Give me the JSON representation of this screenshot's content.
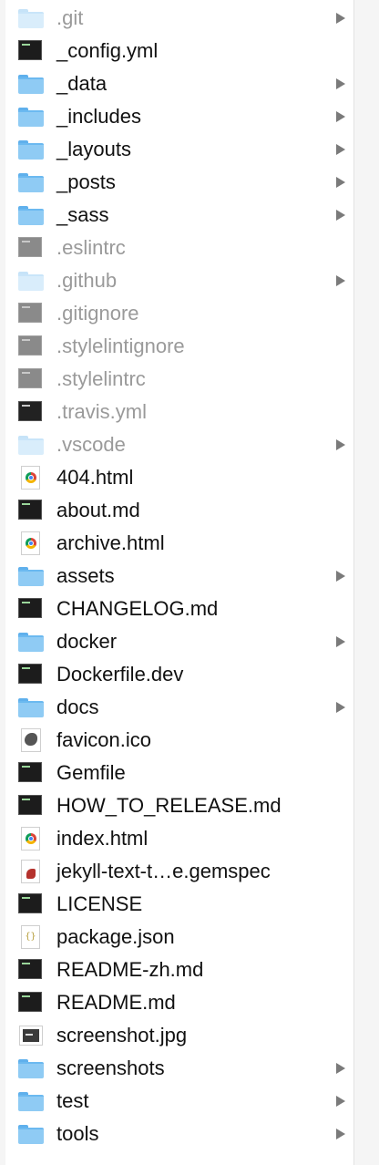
{
  "files": [
    {
      "name": ".git",
      "kind": "folder",
      "hidden": true,
      "expandable": true
    },
    {
      "name": "_config.yml",
      "kind": "terminal-file",
      "hidden": false,
      "expandable": false
    },
    {
      "name": "_data",
      "kind": "folder",
      "hidden": false,
      "expandable": true
    },
    {
      "name": "_includes",
      "kind": "folder",
      "hidden": false,
      "expandable": true
    },
    {
      "name": "_layouts",
      "kind": "folder",
      "hidden": false,
      "expandable": true
    },
    {
      "name": "_posts",
      "kind": "folder",
      "hidden": false,
      "expandable": true
    },
    {
      "name": "_sass",
      "kind": "folder",
      "hidden": false,
      "expandable": true
    },
    {
      "name": ".eslintrc",
      "kind": "terminal-file",
      "hidden": true,
      "expandable": false
    },
    {
      "name": ".github",
      "kind": "folder",
      "hidden": true,
      "expandable": true
    },
    {
      "name": ".gitignore",
      "kind": "terminal-file",
      "hidden": true,
      "expandable": false
    },
    {
      "name": ".stylelintignore",
      "kind": "terminal-file",
      "hidden": true,
      "expandable": false
    },
    {
      "name": ".stylelintrc",
      "kind": "terminal-file",
      "hidden": true,
      "expandable": false
    },
    {
      "name": ".travis.yml",
      "kind": "terminal-file-dark",
      "hidden": true,
      "expandable": false
    },
    {
      "name": ".vscode",
      "kind": "folder",
      "hidden": true,
      "expandable": true
    },
    {
      "name": "404.html",
      "kind": "html-file",
      "hidden": false,
      "expandable": false
    },
    {
      "name": "about.md",
      "kind": "terminal-file",
      "hidden": false,
      "expandable": false
    },
    {
      "name": "archive.html",
      "kind": "html-file",
      "hidden": false,
      "expandable": false
    },
    {
      "name": "assets",
      "kind": "folder",
      "hidden": false,
      "expandable": true
    },
    {
      "name": "CHANGELOG.md",
      "kind": "terminal-file",
      "hidden": false,
      "expandable": false
    },
    {
      "name": "docker",
      "kind": "folder",
      "hidden": false,
      "expandable": true
    },
    {
      "name": "Dockerfile.dev",
      "kind": "terminal-file",
      "hidden": false,
      "expandable": false
    },
    {
      "name": "docs",
      "kind": "folder",
      "hidden": false,
      "expandable": true
    },
    {
      "name": "favicon.ico",
      "kind": "ico-file",
      "hidden": false,
      "expandable": false
    },
    {
      "name": "Gemfile",
      "kind": "terminal-file",
      "hidden": false,
      "expandable": false
    },
    {
      "name": "HOW_TO_RELEASE.md",
      "kind": "terminal-file",
      "hidden": false,
      "expandable": false
    },
    {
      "name": "index.html",
      "kind": "html-file",
      "hidden": false,
      "expandable": false
    },
    {
      "name": "jekyll-text-t…e.gemspec",
      "kind": "gem-file",
      "hidden": false,
      "expandable": false
    },
    {
      "name": "LICENSE",
      "kind": "terminal-file",
      "hidden": false,
      "expandable": false
    },
    {
      "name": "package.json",
      "kind": "json-file",
      "hidden": false,
      "expandable": false
    },
    {
      "name": "README-zh.md",
      "kind": "terminal-file",
      "hidden": false,
      "expandable": false
    },
    {
      "name": "README.md",
      "kind": "terminal-file",
      "hidden": false,
      "expandable": false
    },
    {
      "name": "screenshot.jpg",
      "kind": "image-file",
      "hidden": false,
      "expandable": false
    },
    {
      "name": "screenshots",
      "kind": "folder",
      "hidden": false,
      "expandable": true
    },
    {
      "name": "test",
      "kind": "folder",
      "hidden": false,
      "expandable": true
    },
    {
      "name": "tools",
      "kind": "folder",
      "hidden": false,
      "expandable": true
    }
  ],
  "colors": {
    "folder": "#8fcbf4",
    "hidden_text": "#9a9a9a",
    "text": "#111111",
    "chevron": "#7a7a7a"
  }
}
